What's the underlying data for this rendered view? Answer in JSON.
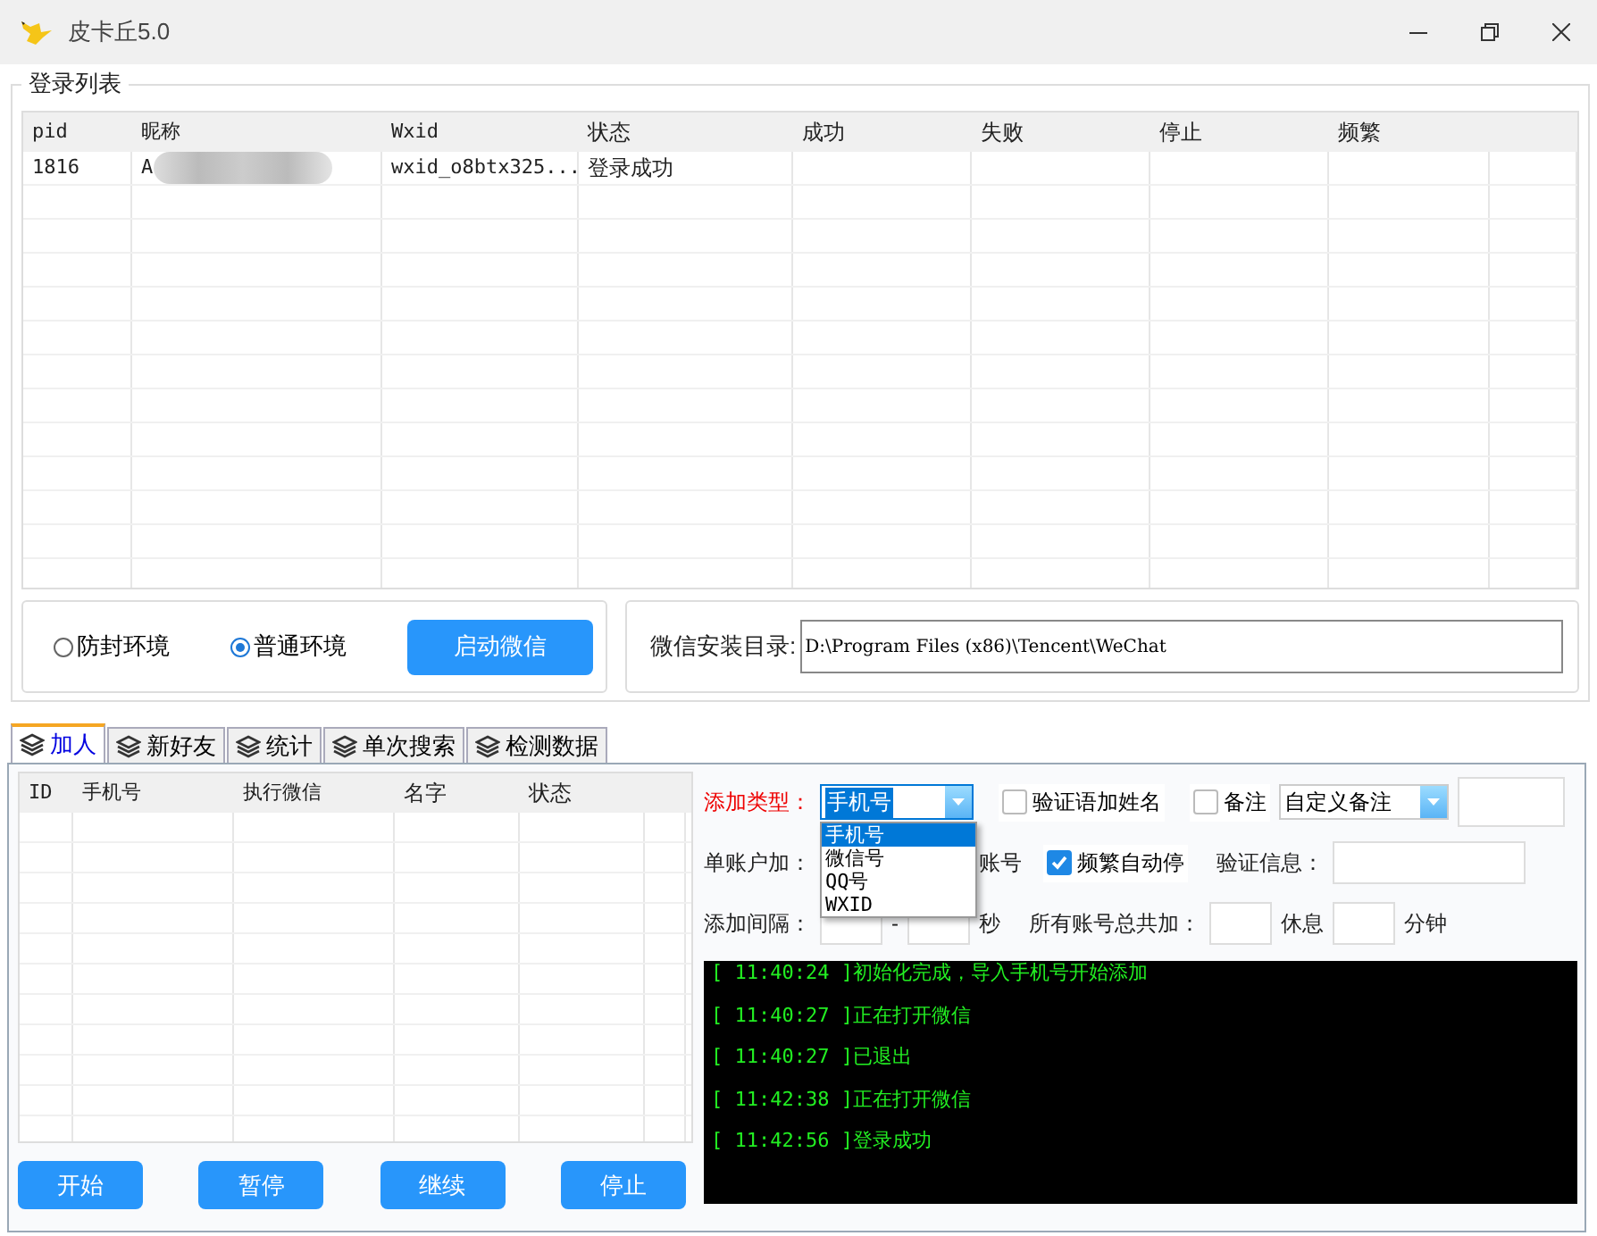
{
  "window": {
    "title": "皮卡丘5.0"
  },
  "login_list": {
    "title": "登录列表",
    "columns": [
      "pid",
      "昵称",
      "Wxid",
      "状态",
      "成功",
      "失败",
      "停止",
      "频繁"
    ],
    "rows": [
      {
        "cells": [
          "1816",
          "A",
          "wxid_o8btx325...",
          "登录成功",
          "",
          "",
          "",
          ""
        ]
      }
    ]
  },
  "environment": {
    "options": [
      {
        "label": "防封环境",
        "selected": false
      },
      {
        "label": "普通环境",
        "selected": true
      }
    ],
    "launch_button": "启动微信"
  },
  "install_dir": {
    "label": "微信安装目录:",
    "value": "D:\\Program Files (x86)\\Tencent\\WeChat"
  },
  "tabs": [
    {
      "label": "加人",
      "selected": true
    },
    {
      "label": "新好友",
      "selected": false
    },
    {
      "label": "统计",
      "selected": false
    },
    {
      "label": "单次搜索",
      "selected": false
    },
    {
      "label": "检测数据",
      "selected": false
    }
  ],
  "task_table": {
    "columns": [
      "ID",
      "手机号",
      "执行微信",
      "名字",
      "状态"
    ]
  },
  "buttons": [
    "开始",
    "暂停",
    "继续",
    "停止"
  ],
  "settings": {
    "add_type": {
      "label": "添加类型：",
      "value": "手机号",
      "expanded": true,
      "options": [
        {
          "label": "手机号",
          "selected": true
        },
        {
          "label": "微信号",
          "selected": false
        },
        {
          "label": "QQ号",
          "selected": false
        },
        {
          "label": "WXID",
          "selected": false
        }
      ]
    },
    "name_in_verify": {
      "label": "验证语加姓名",
      "checked": false
    },
    "remark": {
      "label": "备注",
      "checked": false
    },
    "remark_type": {
      "value": "自定义备注"
    },
    "per_account": {
      "label": "单账户加：",
      "suffix": "账号"
    },
    "auto_stop": {
      "label": "频繁自动停",
      "checked": true
    },
    "verify_info": {
      "label": "验证信息："
    },
    "interval": {
      "label": "添加间隔：",
      "separator": "-",
      "unit": "秒"
    },
    "total": {
      "label": "所有账号总共加：",
      "rest_label": "休息",
      "unit": "分钟"
    }
  },
  "log": [
    {
      "time": "[ 11:40:24 ]",
      "message": "初始化完成，导入手机号开始添加"
    },
    {
      "time": "[ 11:40:27 ]",
      "message": "正在打开微信"
    },
    {
      "time": "[ 11:40:27 ]",
      "message": "已退出"
    },
    {
      "time": "[ 11:42:38 ]",
      "message": "正在打开微信"
    },
    {
      "time": "[ 11:42:56 ]",
      "message": "登录成功"
    }
  ]
}
